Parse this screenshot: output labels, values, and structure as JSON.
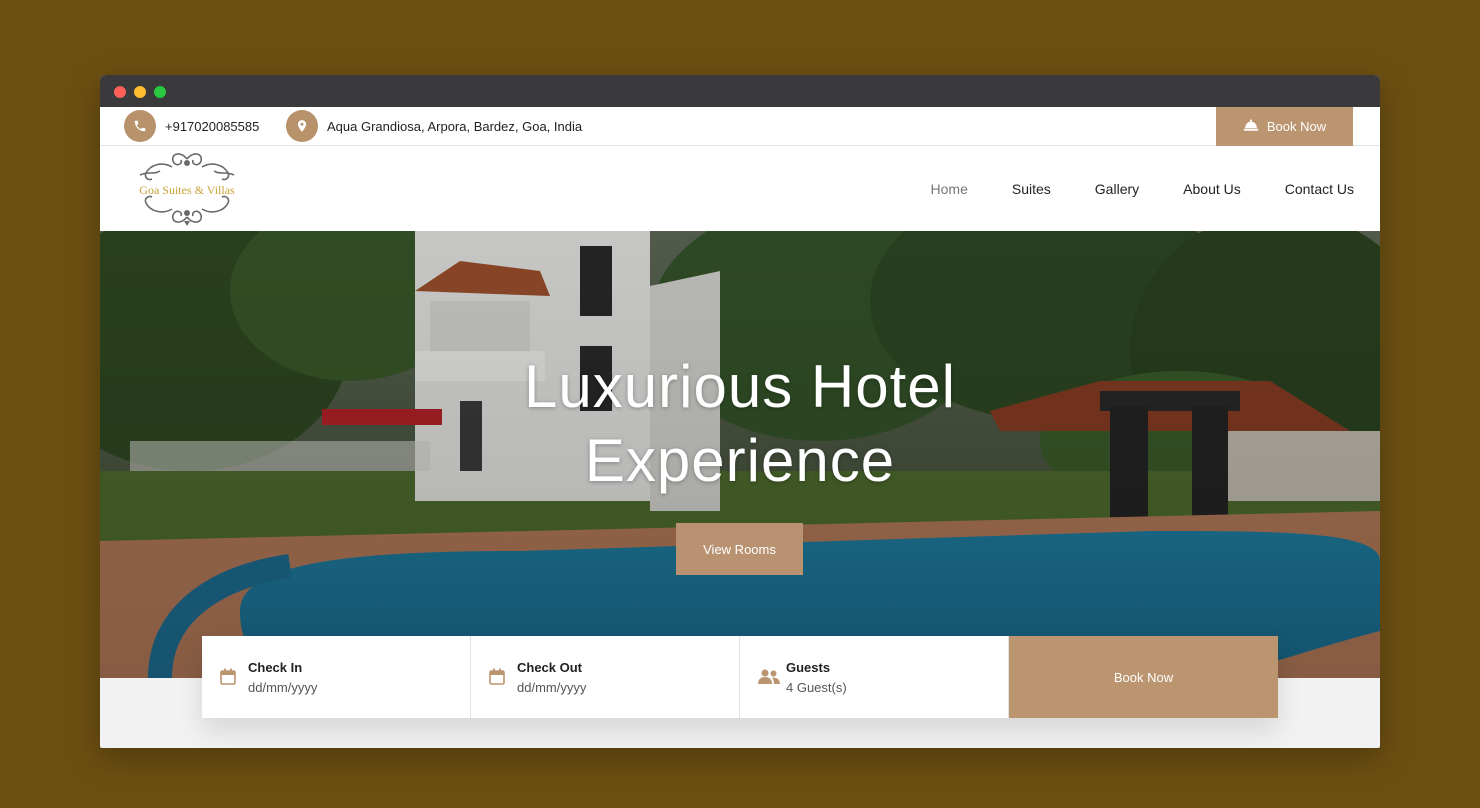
{
  "topbar": {
    "phone": "+917020085585",
    "address": "Aqua Grandiosa, Arpora, Bardez, Goa, India",
    "book_label": "Book Now"
  },
  "logo": {
    "text": "Goa Suites & Villas"
  },
  "nav": {
    "items": [
      "Home",
      "Suites",
      "Gallery",
      "About Us",
      "Contact Us"
    ],
    "active": "Home"
  },
  "hero": {
    "title_line1": "Luxurious Hotel",
    "title_line2": "Experience",
    "cta_label": "View Rooms"
  },
  "booking": {
    "check_in": {
      "label": "Check In",
      "value": "dd/mm/yyyy"
    },
    "check_out": {
      "label": "Check Out",
      "value": "dd/mm/yyyy"
    },
    "guests": {
      "label": "Guests",
      "value": "4 Guest(s)"
    },
    "submit_label": "Book Now"
  },
  "colors": {
    "accent": "#bb9470",
    "background": "#6b4f12",
    "logo_gold": "#c9a136"
  }
}
